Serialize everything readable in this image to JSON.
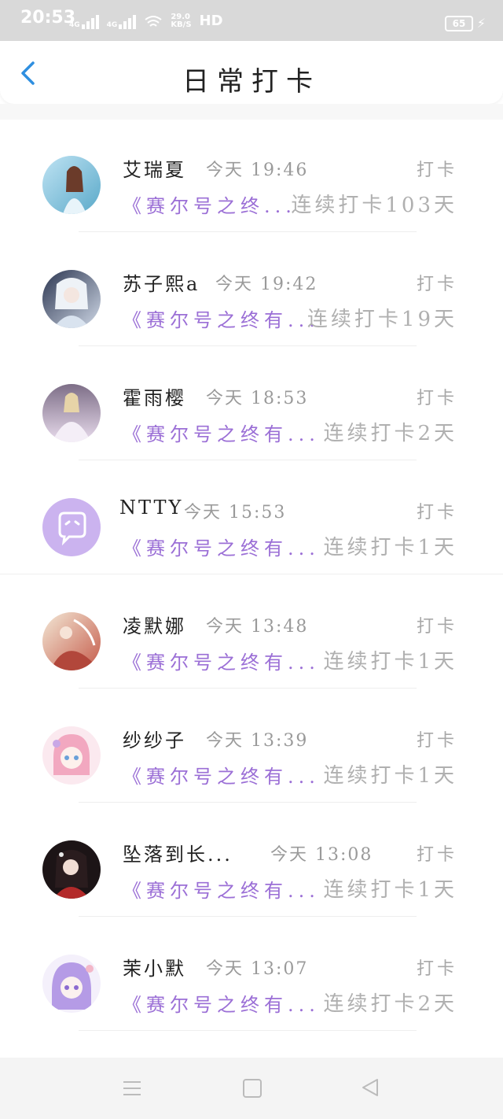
{
  "status_bar": {
    "time": "20:53",
    "network_1": "4G",
    "network_2": "4G",
    "speed_value": "29.0",
    "speed_unit": "KB/S",
    "hd": "HD",
    "battery": "65"
  },
  "header": {
    "title": "日常打卡",
    "back_icon": "chevron-left-icon"
  },
  "colors": {
    "book_purple": "#9b6fd6",
    "back_blue": "#2f8fe0",
    "muted_gray": "#a8a8a8"
  },
  "entries": [
    {
      "name": "艾瑞夏",
      "time": "今天 19:46",
      "action": "打卡",
      "book": "《赛尔号之终...",
      "streak": "连续打卡103天",
      "avatar": "avatar-a"
    },
    {
      "name": "苏子熙a",
      "time": "今天 19:42",
      "action": "打卡",
      "book": "《赛尔号之终有...",
      "streak": "连续打卡19天",
      "avatar": "avatar-b"
    },
    {
      "name": "霍雨樱",
      "time": "今天 18:53",
      "action": "打卡",
      "book": "《赛尔号之终有...",
      "streak": "连续打卡2天",
      "avatar": "avatar-c"
    },
    {
      "name": "NTTY",
      "time": "今天 15:53",
      "action": "打卡",
      "book": "《赛尔号之终有...",
      "streak": "连续打卡1天",
      "avatar": "default-chat-avatar"
    },
    {
      "name": "凌默娜",
      "time": "今天 13:48",
      "action": "打卡",
      "book": "《赛尔号之终有...",
      "streak": "连续打卡1天",
      "avatar": "avatar-e"
    },
    {
      "name": "纱纱子",
      "time": "今天 13:39",
      "action": "打卡",
      "book": "《赛尔号之终有...",
      "streak": "连续打卡1天",
      "avatar": "avatar-f"
    },
    {
      "name": "坠落到长...",
      "time": "今天 13:08",
      "action": "打卡",
      "book": "《赛尔号之终有...",
      "streak": "连续打卡1天",
      "avatar": "avatar-g"
    },
    {
      "name": "茉小默",
      "time": "今天 13:07",
      "action": "打卡",
      "book": "《赛尔号之终有...",
      "streak": "连续打卡2天",
      "avatar": "avatar-h"
    }
  ],
  "nav": {
    "menu_icon": "menu-icon",
    "home_icon": "home-square-icon",
    "back_icon": "back-triangle-icon"
  }
}
